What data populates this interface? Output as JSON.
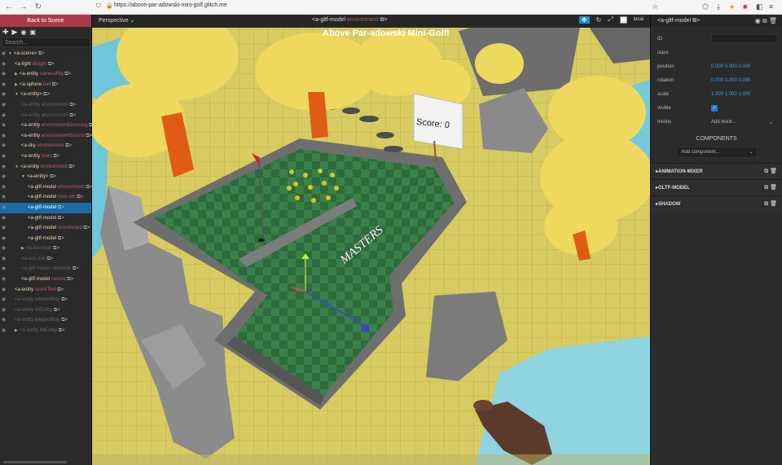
{
  "browser": {
    "url": "https://above-par-adowski-mini-golf.glitch.me"
  },
  "left": {
    "back": "Back to Scene",
    "search_placeholder": "Search...",
    "tree": [
      {
        "t": "<a-scene>",
        "id": "",
        "lvl": 0,
        "tri": "▼",
        "dim": false
      },
      {
        "t": "<a-light",
        "id": "dirlight",
        "lvl": 1,
        "tri": "",
        "dim": false
      },
      {
        "t": "<a-entity",
        "id": "cameraRig",
        "lvl": 1,
        "tri": "▶",
        "dim": false
      },
      {
        "t": "<a-sphere",
        "id": "ball",
        "lvl": 1,
        "tri": "▶",
        "dim": false
      },
      {
        "t": "<a-entity>",
        "id": "",
        "lvl": 1,
        "tri": "▼",
        "dim": false
      },
      {
        "t": "<a-entity environment",
        "id": "",
        "lvl": 2,
        "tri": "",
        "dim": true
      },
      {
        "t": "<a-entity environment",
        "id": "",
        "lvl": 2,
        "tri": "",
        "dim": true
      },
      {
        "t": "<a-entity",
        "id": "environmentDressing",
        "lvl": 2,
        "tri": "",
        "dim": false
      },
      {
        "t": "<a-entity",
        "id": "environmentGround",
        "lvl": 2,
        "tri": "",
        "dim": false
      },
      {
        "t": "<a-sky",
        "id": "environment",
        "lvl": 2,
        "tri": "",
        "dim": false
      },
      {
        "t": "<a-entity",
        "id": "stars",
        "lvl": 2,
        "tri": "",
        "dim": false
      },
      {
        "t": "<a-entity",
        "id": "environment",
        "lvl": 1,
        "tri": "▼",
        "dim": false
      },
      {
        "t": "<a-entity>",
        "id": "",
        "lvl": 2,
        "tri": "▼",
        "dim": false
      },
      {
        "t": "<a-gltf-model",
        "id": "environment",
        "lvl": 3,
        "tri": "",
        "dim": false
      },
      {
        "t": "<a-gltf-model",
        "id": "river-sm",
        "lvl": 3,
        "tri": "",
        "dim": false
      },
      {
        "t": "<a-gltf-model",
        "id": "",
        "lvl": 3,
        "tri": "",
        "dim": false,
        "sel": true
      },
      {
        "t": "<a-gltf-model",
        "id": "",
        "lvl": 3,
        "tri": "",
        "dim": false
      },
      {
        "t": "<a-gltf-model",
        "id": "scoreboard",
        "lvl": 3,
        "tri": "",
        "dim": false
      },
      {
        "t": "<a-gltf-model",
        "id": "",
        "lvl": 3,
        "tri": "",
        "dim": false
      },
      {
        "t": "<a-box hole",
        "id": "",
        "lvl": 2,
        "tri": "▶",
        "dim": true
      },
      {
        "t": "<a-box ooti",
        "id": "",
        "lvl": 2,
        "tri": "",
        "dim": true
      },
      {
        "t": "<a-gltf-model navmesh",
        "id": "",
        "lvl": 2,
        "tri": "",
        "dim": true
      },
      {
        "t": "<a-gltf-model",
        "id": "course",
        "lvl": 2,
        "tri": "",
        "dim": false
      },
      {
        "t": "<a-entity",
        "id": "scoreText",
        "lvl": 1,
        "tri": "",
        "dim": false
      },
      {
        "t": "<a-entity teleportRay",
        "id": "",
        "lvl": 1,
        "tri": "",
        "dim": true
      },
      {
        "t": "<a-entity hitEntity",
        "id": "",
        "lvl": 1,
        "tri": "",
        "dim": true
      },
      {
        "t": "<a-entity teleportRay",
        "id": "",
        "lvl": 1,
        "tri": "",
        "dim": true
      },
      {
        "t": "<a-entity hitEntity",
        "id": "",
        "lvl": 1,
        "tri": "▶",
        "dim": true
      }
    ]
  },
  "viewport": {
    "camera": "Perspective",
    "selection": "<a-gltf-model",
    "selection_id": "environment",
    "local": "local",
    "game_title": "Above Par-adowski Mini-Golf!",
    "score": "Score: 0",
    "sign": "MASTERS"
  },
  "right": {
    "header": "<a-gltf-model",
    "props": {
      "id": "ID",
      "class": "class",
      "position": "position",
      "rotation": "rotation",
      "scale": "scale",
      "visible": "visible",
      "mixins": "mixins"
    },
    "position": [
      "0.000",
      "0.000",
      "0.000"
    ],
    "rotation": [
      "0.000",
      "0.000",
      "0.000"
    ],
    "scale": [
      "1.000",
      "1.000",
      "1.000"
    ],
    "mixin_ph": "Add mixin...",
    "components_title": "COMPONENTS",
    "add_component": "Add component...",
    "components": [
      "ANIMATION-MIXER",
      "GLTF-MODEL",
      "SHADOW"
    ]
  }
}
